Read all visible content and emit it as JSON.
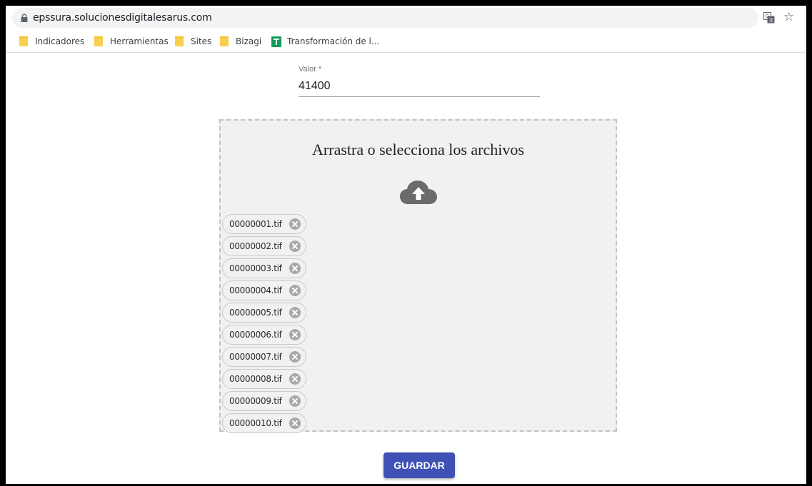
{
  "browser": {
    "url": "epssura.solucionesdigitalesarus.com",
    "icons": {
      "lock": "lock-icon",
      "translate": "translate-icon",
      "bookmark": "star-icon"
    }
  },
  "bookmarks": [
    {
      "label": "Indicadores",
      "icon": "folder-icon"
    },
    {
      "label": "Herramientas",
      "icon": "folder-icon"
    },
    {
      "label": "Sites",
      "icon": "folder-icon"
    },
    {
      "label": "Bizagi",
      "icon": "folder-icon"
    },
    {
      "label": "Transformación de l...",
      "icon": "sheets-icon"
    }
  ],
  "form": {
    "valor": {
      "label": "Valor *",
      "value": "41400"
    }
  },
  "dropzone": {
    "title": "Arrastra o selecciona los archivos",
    "icon": "cloud-upload-icon",
    "files": [
      "00000001.tif",
      "00000002.tif",
      "00000003.tif",
      "00000004.tif",
      "00000005.tif",
      "00000006.tif",
      "00000007.tif",
      "00000008.tif",
      "00000009.tif",
      "00000010.tif"
    ]
  },
  "actions": {
    "save_label": "GUARDAR"
  },
  "colors": {
    "primary": "#3f51b5",
    "dropzone_bg": "#f1f1f1",
    "chip_remove": "#a8a8a8"
  }
}
